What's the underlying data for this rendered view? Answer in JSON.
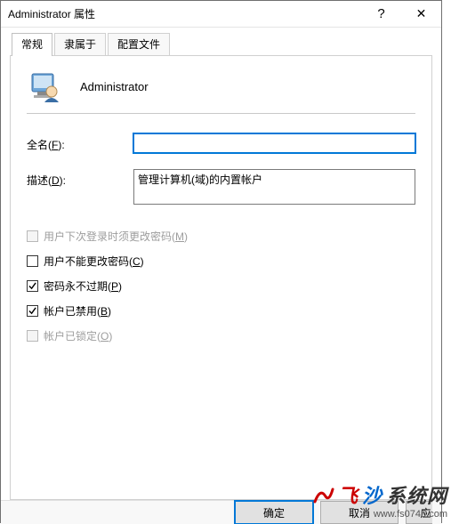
{
  "window": {
    "title": "Administrator 属性",
    "help": "?",
    "close": "✕"
  },
  "tabs": {
    "general": "常规",
    "memberOf": "隶属于",
    "profile": "配置文件"
  },
  "header": {
    "username": "Administrator"
  },
  "fields": {
    "fullNameLabelBase": "全名(",
    "fullNameKey": "F",
    "fullNameLabelEnd": "):",
    "fullNameValue": "",
    "descLabelBase": "描述(",
    "descKey": "D",
    "descLabelEnd": "):",
    "descValue": "管理计算机(域)的内置帐户"
  },
  "checks": {
    "mustChangeBase": "用户下次登录时须更改密码(",
    "mustChangeKey": "M",
    "mustChangeEnd": ")",
    "cannotChangeBase": "用户不能更改密码(",
    "cannotChangeKey": "C",
    "cannotChangeEnd": ")",
    "neverExpiresBase": "密码永不过期(",
    "neverExpiresKey": "P",
    "neverExpiresEnd": ")",
    "disabledBase": "帐户已禁用(",
    "disabledKey": "B",
    "disabledEnd": ")",
    "lockedBase": "帐户已锁定(",
    "lockedKey": "O",
    "lockedEnd": ")"
  },
  "buttons": {
    "ok": "确定",
    "cancel": "取消",
    "applyPartial": "应"
  },
  "watermark": {
    "fei": "飞",
    "sha": "沙",
    "rest": "系统网",
    "url": "www.fs0745.com"
  }
}
